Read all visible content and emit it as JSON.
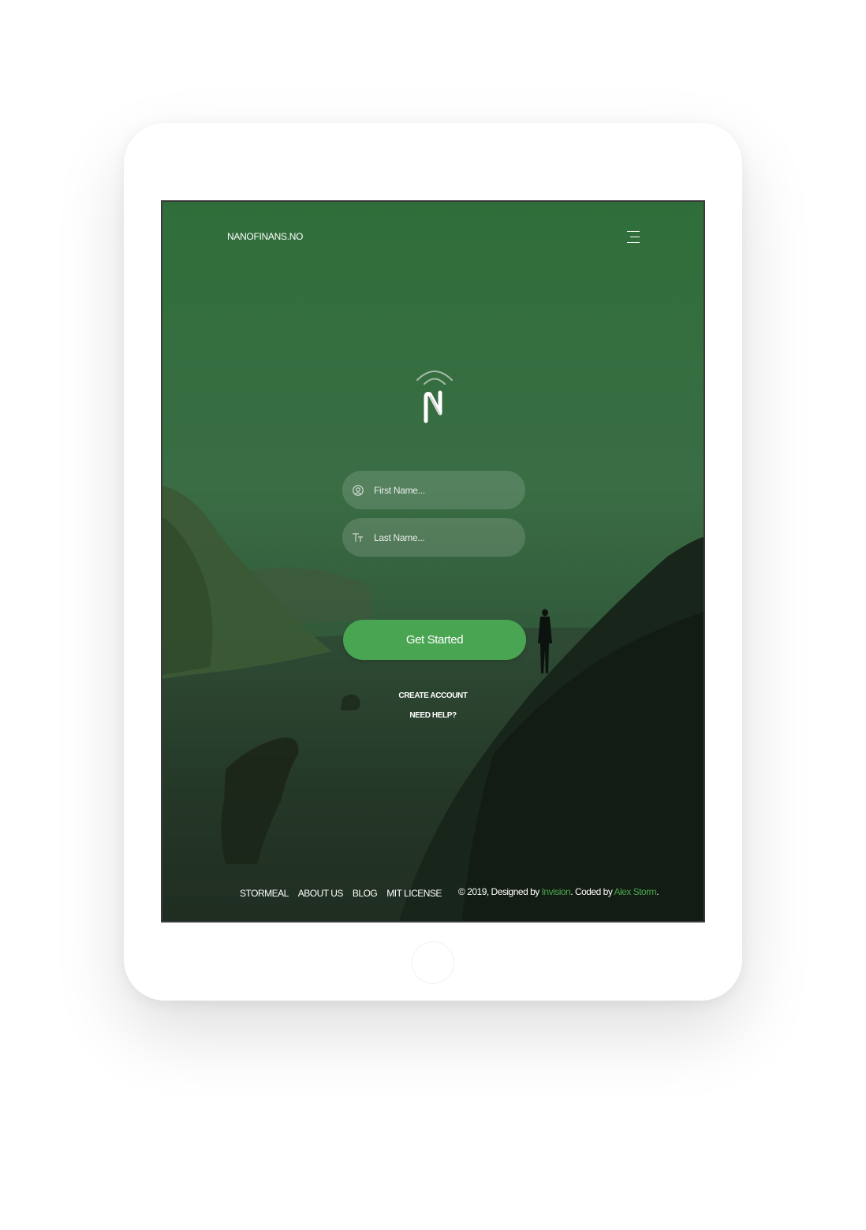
{
  "header": {
    "brand": "NANOFINANS.NO",
    "menu_icon": "hamburger-menu-icon"
  },
  "logo": {
    "letter": "N",
    "icon": "wifi-arc-logo-icon"
  },
  "form": {
    "first_name": {
      "placeholder": "First Name...",
      "value": "",
      "icon": "user-circle-icon"
    },
    "last_name": {
      "placeholder": "Last Name...",
      "value": "",
      "icon": "text-type-icon"
    },
    "submit_label": "Get Started"
  },
  "links": {
    "create_account": "CREATE ACCOUNT",
    "need_help": "NEED HELP?"
  },
  "footer": {
    "nav": [
      "STORMEAL",
      "ABOUT US",
      "BLOG",
      "MIT LICENSE"
    ],
    "copyright_prefix": "© 2019, Designed by ",
    "designer": "Invision",
    "coded_by_text": ". Coded by ",
    "coder": "Alex Storm",
    "suffix": "."
  },
  "colors": {
    "accent": "#4aa552",
    "overlay_top": "#2f6e3a",
    "overlay_bottom": "#111a12"
  }
}
